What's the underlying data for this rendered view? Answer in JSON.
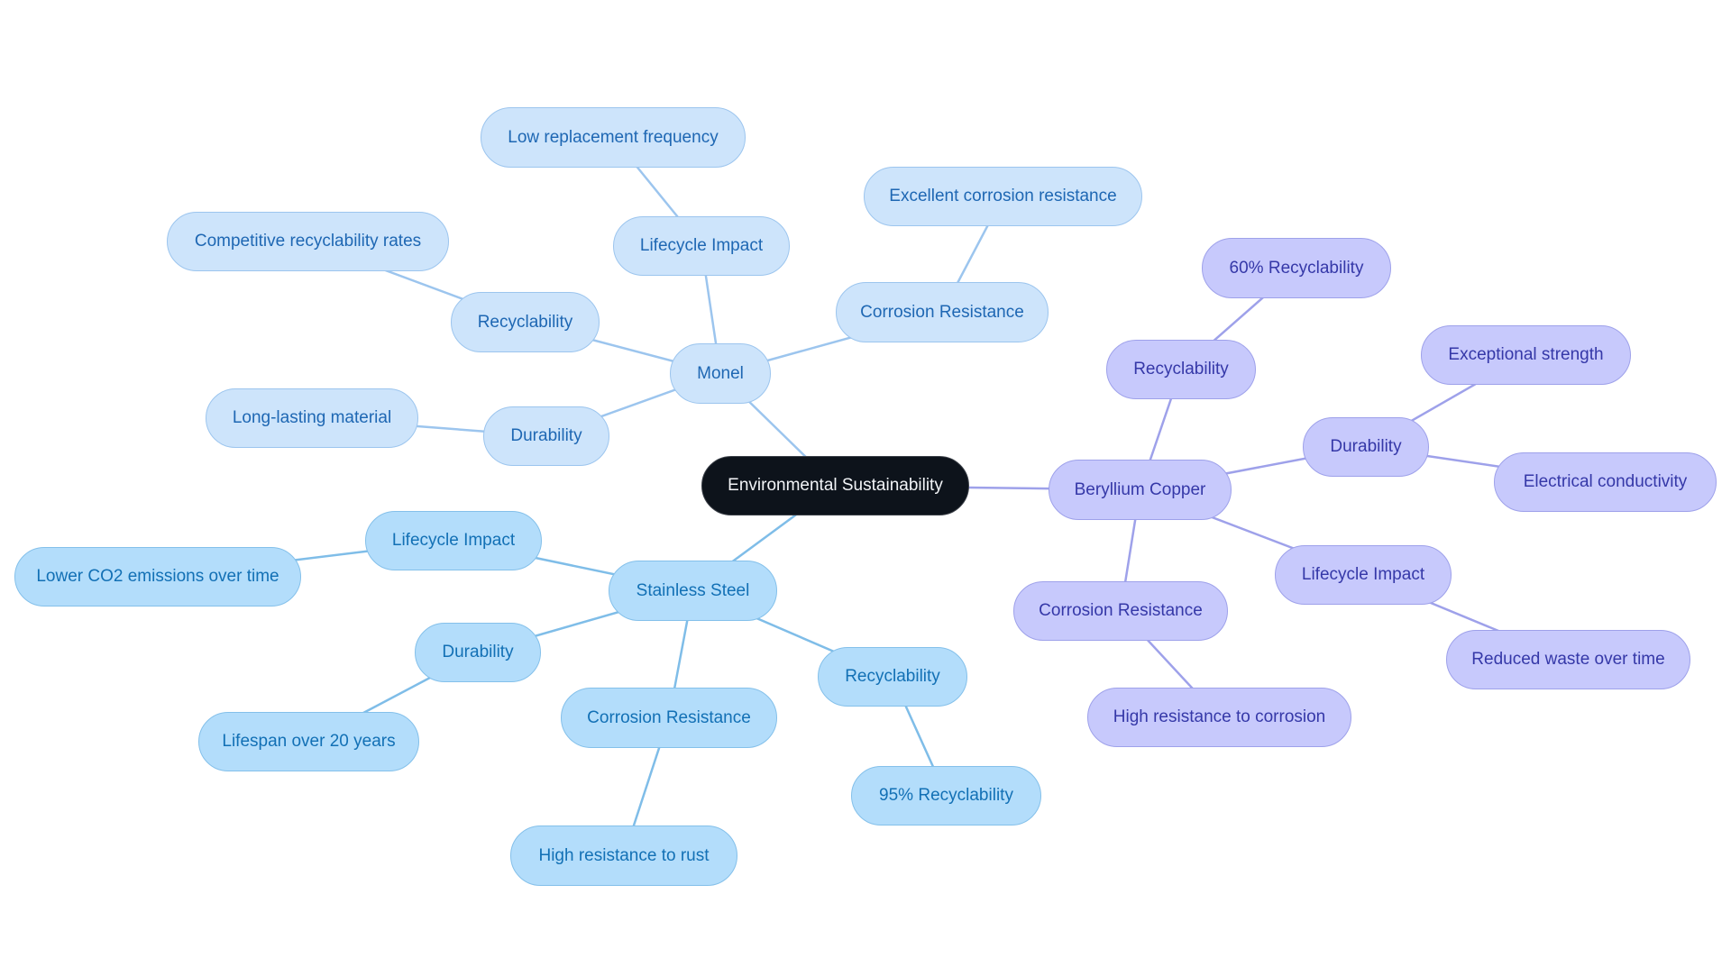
{
  "root": {
    "label": "Environmental Sustainability"
  },
  "colors": {
    "monel_edge": "#9cc5ee",
    "steel_edge": "#7fbde8",
    "beryl_edge": "#9ea1ea"
  },
  "branches": {
    "monel": {
      "label": "Monel",
      "children": {
        "lifecycle": {
          "label": "Lifecycle Impact",
          "leaf": "Low replacement frequency"
        },
        "corrosion": {
          "label": "Corrosion Resistance",
          "leaf": "Excellent corrosion resistance"
        },
        "recyclability": {
          "label": "Recyclability",
          "leaf": "Competitive recyclability rates"
        },
        "durability": {
          "label": "Durability",
          "leaf": "Long-lasting material"
        }
      }
    },
    "steel": {
      "label": "Stainless Steel",
      "children": {
        "lifecycle": {
          "label": "Lifecycle Impact",
          "leaf": "Lower CO2 emissions over time"
        },
        "durability": {
          "label": "Durability",
          "leaf": "Lifespan over 20 years"
        },
        "corrosion": {
          "label": "Corrosion Resistance",
          "leaf": "High resistance to rust"
        },
        "recyclability": {
          "label": "Recyclability",
          "leaf": "95% Recyclability"
        }
      }
    },
    "beryl": {
      "label": "Beryllium Copper",
      "children": {
        "recyclability": {
          "label": "Recyclability",
          "leaf": "60% Recyclability"
        },
        "durability": {
          "label": "Durability",
          "leaf1": "Exceptional strength",
          "leaf2": "Electrical conductivity"
        },
        "lifecycle": {
          "label": "Lifecycle Impact",
          "leaf": "Reduced waste over time"
        },
        "corrosion": {
          "label": "Corrosion Resistance",
          "leaf": "High resistance to corrosion"
        }
      }
    }
  }
}
